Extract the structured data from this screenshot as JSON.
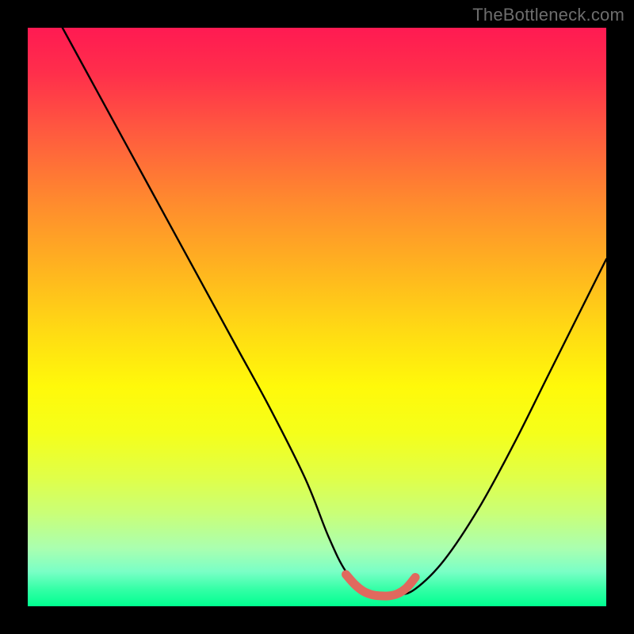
{
  "watermark": "TheBottleneck.com",
  "chart_data": {
    "type": "line",
    "title": "",
    "xlabel": "",
    "ylabel": "",
    "xlim": [
      0,
      100
    ],
    "ylim": [
      0,
      100
    ],
    "series": [
      {
        "name": "black-curve",
        "color": "#000000",
        "x": [
          6,
          12,
          18,
          24,
          30,
          36,
          42,
          48,
          52,
          55,
          58,
          61,
          64,
          67,
          72,
          78,
          84,
          90,
          96,
          100
        ],
        "values": [
          100,
          89,
          78,
          67,
          56,
          45,
          34,
          22,
          12,
          6,
          3,
          2,
          2,
          3,
          8,
          17,
          28,
          40,
          52,
          60
        ]
      },
      {
        "name": "red-minimum-band",
        "color": "#e0695e",
        "x": [
          55,
          56.5,
          58,
          59.5,
          61,
          62.5,
          64,
          65.5,
          67
        ],
        "values": [
          5.5,
          3.8,
          2.6,
          2.0,
          1.8,
          1.8,
          2.2,
          3.2,
          5.0
        ]
      }
    ],
    "background_gradient": {
      "top": "#ff1a52",
      "bottom": "#00ff90"
    }
  }
}
